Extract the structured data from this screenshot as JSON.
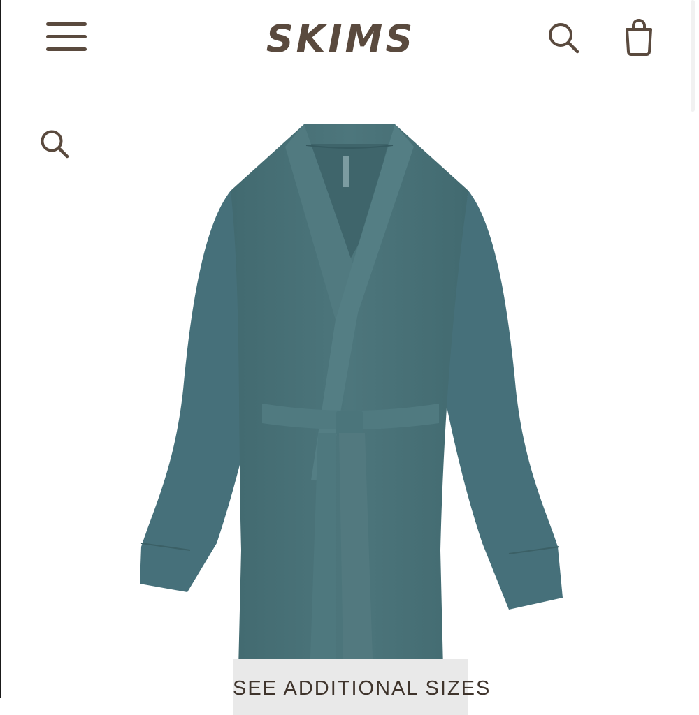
{
  "header": {
    "brand": "SKIMS",
    "icons": {
      "menu": "hamburger-menu-icon",
      "search": "search-icon",
      "bag": "shopping-bag-icon"
    }
  },
  "product": {
    "search_icon": "search-icon",
    "image_description": "teal robe",
    "color": "#4b7378",
    "cta_label": "SEE ADDITIONAL SIZES"
  },
  "colors": {
    "brand_brown": "#5a4a3e",
    "cta_background": "#e9e9e9"
  }
}
